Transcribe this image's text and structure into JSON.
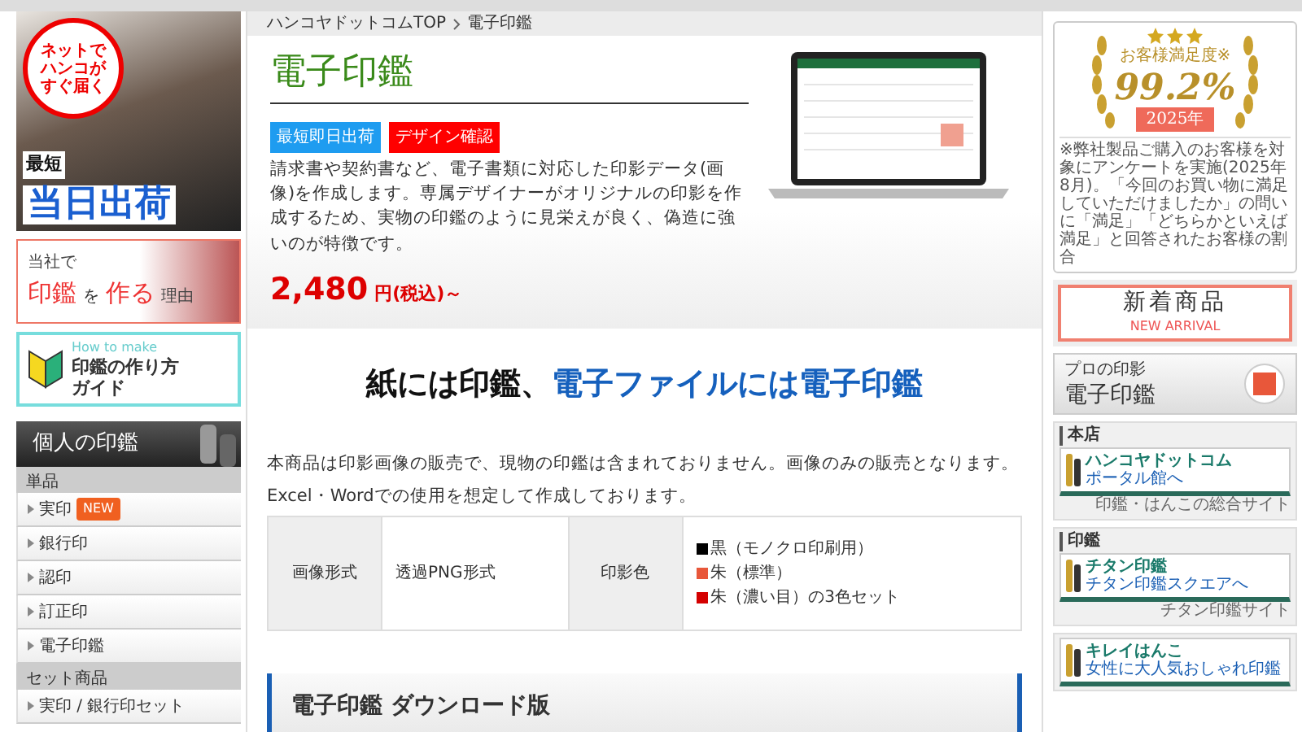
{
  "left_banners": {
    "shipping": {
      "slogan": [
        "ネットで",
        "ハンコが",
        "すぐ届く"
      ],
      "lead": "最短",
      "headline": "当日出荷"
    },
    "reason": {
      "lead": "当社で",
      "main": "印鑑",
      "particle": "を",
      "verb": "作る",
      "tail": "理由"
    },
    "guide": {
      "eyebrow": "How to make",
      "lines": [
        "印鑑の作り方",
        "ガイド"
      ]
    }
  },
  "side_menu": {
    "title": "個人の印鑑",
    "groups": [
      {
        "heading": "単品",
        "items": [
          {
            "label": "実印",
            "badge": "NEW"
          },
          {
            "label": "銀行印"
          },
          {
            "label": "認印"
          },
          {
            "label": "訂正印"
          },
          {
            "label": "電子印鑑"
          }
        ]
      },
      {
        "heading": "セット商品",
        "items": [
          {
            "label": "実印 / 銀行印セット"
          }
        ]
      }
    ]
  },
  "breadcrumb": [
    "ハンコヤドットコムTOP",
    "電子印鑑"
  ],
  "product": {
    "title": "電子印鑑",
    "tags": [
      {
        "label": "最短即日出荷",
        "color": "#1e9cf0"
      },
      {
        "label": "デザイン確認",
        "color": "#ff0000"
      }
    ],
    "description": "請求書や契約書など、電子書類に対応した印影データ(画像)を作成します。専属デザイナーがオリジナルの印影を作成するため、実物の印鑑のように見栄えが良く、偽造に強いのが特徴です。",
    "price": "2,480",
    "price_suffix": "円(税込)～"
  },
  "headline": [
    {
      "text": "紙には印鑑、",
      "kind": "plain"
    },
    {
      "text": "電子ファイルには電子印鑑",
      "kind": "accent"
    }
  ],
  "notice": [
    "本商品は印影画像の販売で、現物の印鑑は含まれておりません。画像のみの販売となります。",
    "Excel・Wordでの使用を想定して作成しております。"
  ],
  "spec_table": [
    {
      "label": "画像形式",
      "kind": "text",
      "value": "透過PNG形式"
    },
    {
      "label": "印影色",
      "kind": "colors",
      "options": [
        {
          "text": "黒（モノクロ印刷用）",
          "color": "#000000"
        },
        {
          "text": "朱（標準）",
          "color": "#e8573a"
        },
        {
          "text": "朱（濃い目）の3色セット",
          "color": "#d40000"
        }
      ]
    }
  ],
  "section_title": "電子印鑑 ダウンロード版",
  "satisfaction": {
    "label": "お客様満足度※",
    "rate": "99.2%",
    "year": "2025年",
    "note": "※弊社製品ご購入のお客様を対象にアンケートを実施(2025年8月)。「今回のお買い物に満足していただけましたか」の問いに「満足」「どちらかといえば満足」と回答されたお客様の割合"
  },
  "new_arrival": {
    "title": "新着商品",
    "subtitle": "NEW ARRIVAL"
  },
  "pro_banner": {
    "lead": "プロの印影",
    "title": "電子印鑑"
  },
  "shops": [
    {
      "heading": "本店",
      "title": "ハンコヤドットコム",
      "sub": "ポータル館へ",
      "caption": "印鑑・はんこの総合サイト"
    },
    {
      "heading": "印鑑",
      "title": "チタン印鑑",
      "sub": "チタン印鑑スクエアへ",
      "caption": "チタン印鑑サイト"
    },
    {
      "title": "キレイはんこ",
      "sub": "女性に大人気おしゃれ印鑑"
    }
  ]
}
